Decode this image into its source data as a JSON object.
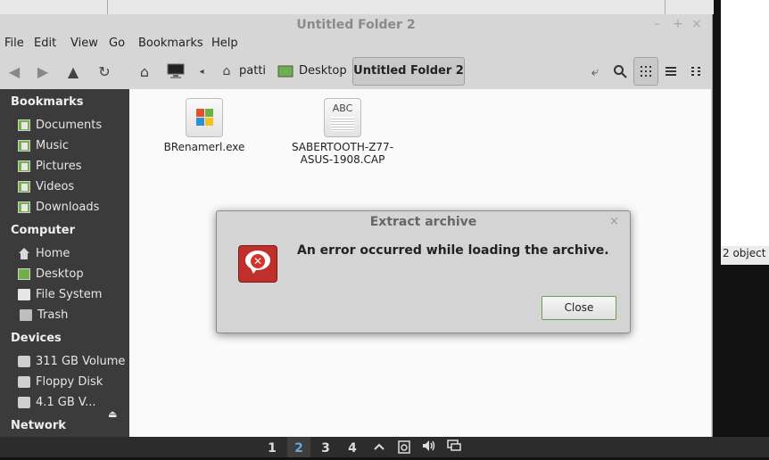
{
  "window": {
    "title": "Untitled Folder 2"
  },
  "menu": [
    "File",
    "Edit",
    "View",
    "Go",
    "Bookmarks",
    "Help"
  ],
  "breadcrumbs": {
    "home": "patti",
    "desktop": "Desktop",
    "current": "Untitled Folder 2"
  },
  "sidebar": {
    "bookmarks_label": "Bookmarks",
    "bookmarks": [
      "Documents",
      "Music",
      "Pictures",
      "Videos",
      "Downloads"
    ],
    "computer_label": "Computer",
    "computer": [
      "Home",
      "Desktop",
      "File System",
      "Trash"
    ],
    "devices_label": "Devices",
    "devices": [
      "311 GB Volume",
      "Floppy Disk",
      "4.1 GB V..."
    ],
    "network_label": "Network"
  },
  "files": [
    {
      "name": "BRenamerl.exe"
    },
    {
      "name_line1": "SABERTOOTH-Z77-",
      "name_line2": "ASUS-1908.CAP",
      "icon_text": "ABC"
    }
  ],
  "dialog": {
    "title": "Extract archive",
    "message": "An error occurred while loading the archive.",
    "button": "Close"
  },
  "background_window": {
    "status": "2 object"
  },
  "panel": {
    "workspaces": [
      "1",
      "2",
      "3",
      "4"
    ],
    "active_workspace": "2"
  },
  "colors": {
    "sidebar_bg": "#3b3b3b",
    "folder_green": "#76b24c",
    "error_red": "#c0302a",
    "button_border": "#6e9f4e"
  }
}
